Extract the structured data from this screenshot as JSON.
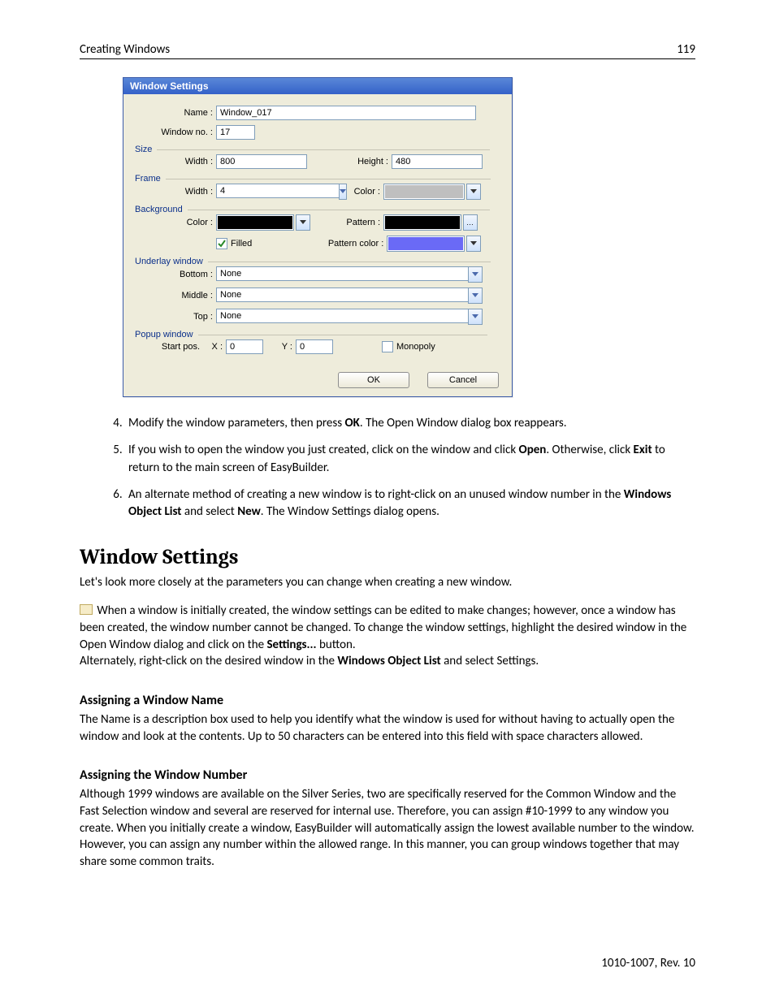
{
  "header": {
    "left": "Creating Windows",
    "right": "119"
  },
  "dialog": {
    "title": "Window Settings",
    "name_label": "Name :",
    "name_value": "Window_017",
    "window_no_label": "Window no. :",
    "window_no_value": "17",
    "groups": {
      "size": {
        "title": "Size",
        "width_label": "Width :",
        "width_value": "800",
        "height_label": "Height :",
        "height_value": "480"
      },
      "frame": {
        "title": "Frame",
        "width_label": "Width :",
        "width_value": "4",
        "color_label": "Color :",
        "color_hex": "#bfbfbf"
      },
      "background": {
        "title": "Background",
        "color_label": "Color :",
        "color_hex": "#000000",
        "pattern_label": "Pattern :",
        "pattern_hex": "#000000",
        "filled_label": "Filled",
        "filled_checked": true,
        "pattern_color_label": "Pattern color :",
        "pattern_color_hex": "#6a6af6"
      },
      "underlay": {
        "title": "Underlay window",
        "bottom_label": "Bottom :",
        "bottom_value": "None",
        "middle_label": "Middle :",
        "middle_value": "None",
        "top_label": "Top :",
        "top_value": "None"
      },
      "popup": {
        "title": "Popup window",
        "startpos_label": "Start pos.",
        "x_label": "X :",
        "x_value": "0",
        "y_label": "Y :",
        "y_value": "0",
        "monopoly_label": "Monopoly",
        "monopoly_checked": false
      }
    },
    "ok": "OK",
    "cancel": "Cancel"
  },
  "steps": {
    "s4_a": "Modify the window parameters, then press ",
    "s4_b": "OK",
    "s4_c": ". The Open Window dialog box reappears.",
    "s5_a": "If you wish to open the window you just created, click on the window and click ",
    "s5_b": "Open",
    "s5_c": ". Otherwise, click ",
    "s5_d": "Exit",
    "s5_e": " to return to the main screen of EasyBuilder.",
    "s6_a": "An alternate method of creating a new window is to right-click on an unused window number in the ",
    "s6_b": "Windows Object List",
    "s6_c": " and select ",
    "s6_d": "New",
    "s6_e": ". The Window Settings dialog opens."
  },
  "section": {
    "heading": "Window Settings",
    "intro": "Let's look more closely at the parameters you can change when creating a new window.",
    "note_a": " When a window is initially created, the window settings can be edited to make changes; however, once a window has been created, the window number cannot be changed. To change the window settings, highlight the desired window in the Open Window dialog and click on the ",
    "note_b": "Settings...",
    "note_c": " button.",
    "note_d": "Alternately, right-click on the desired window in the ",
    "note_e": "Windows Object List",
    "note_f": " and select Settings."
  },
  "sub1": {
    "heading": "Assigning a Window Name",
    "body": "The Name is a description box used to help you identify what the window is used for without having to actually open the window and look at the contents. Up to 50 characters can be entered into this field with space characters allowed."
  },
  "sub2": {
    "heading": "Assigning the Window Number",
    "body": "Although 1999 windows are available on the Silver Series, two are specifically reserved for the Common Window and the Fast Selection window and several are reserved for internal use. Therefore, you can assign #10-1999 to any window you create. When you initially create a window, EasyBuilder will automatically assign the lowest available number to the window. However, you can assign any number within the allowed range. In this manner, you can group windows together that may share some common traits."
  },
  "footer": "1010-1007, Rev. 10"
}
